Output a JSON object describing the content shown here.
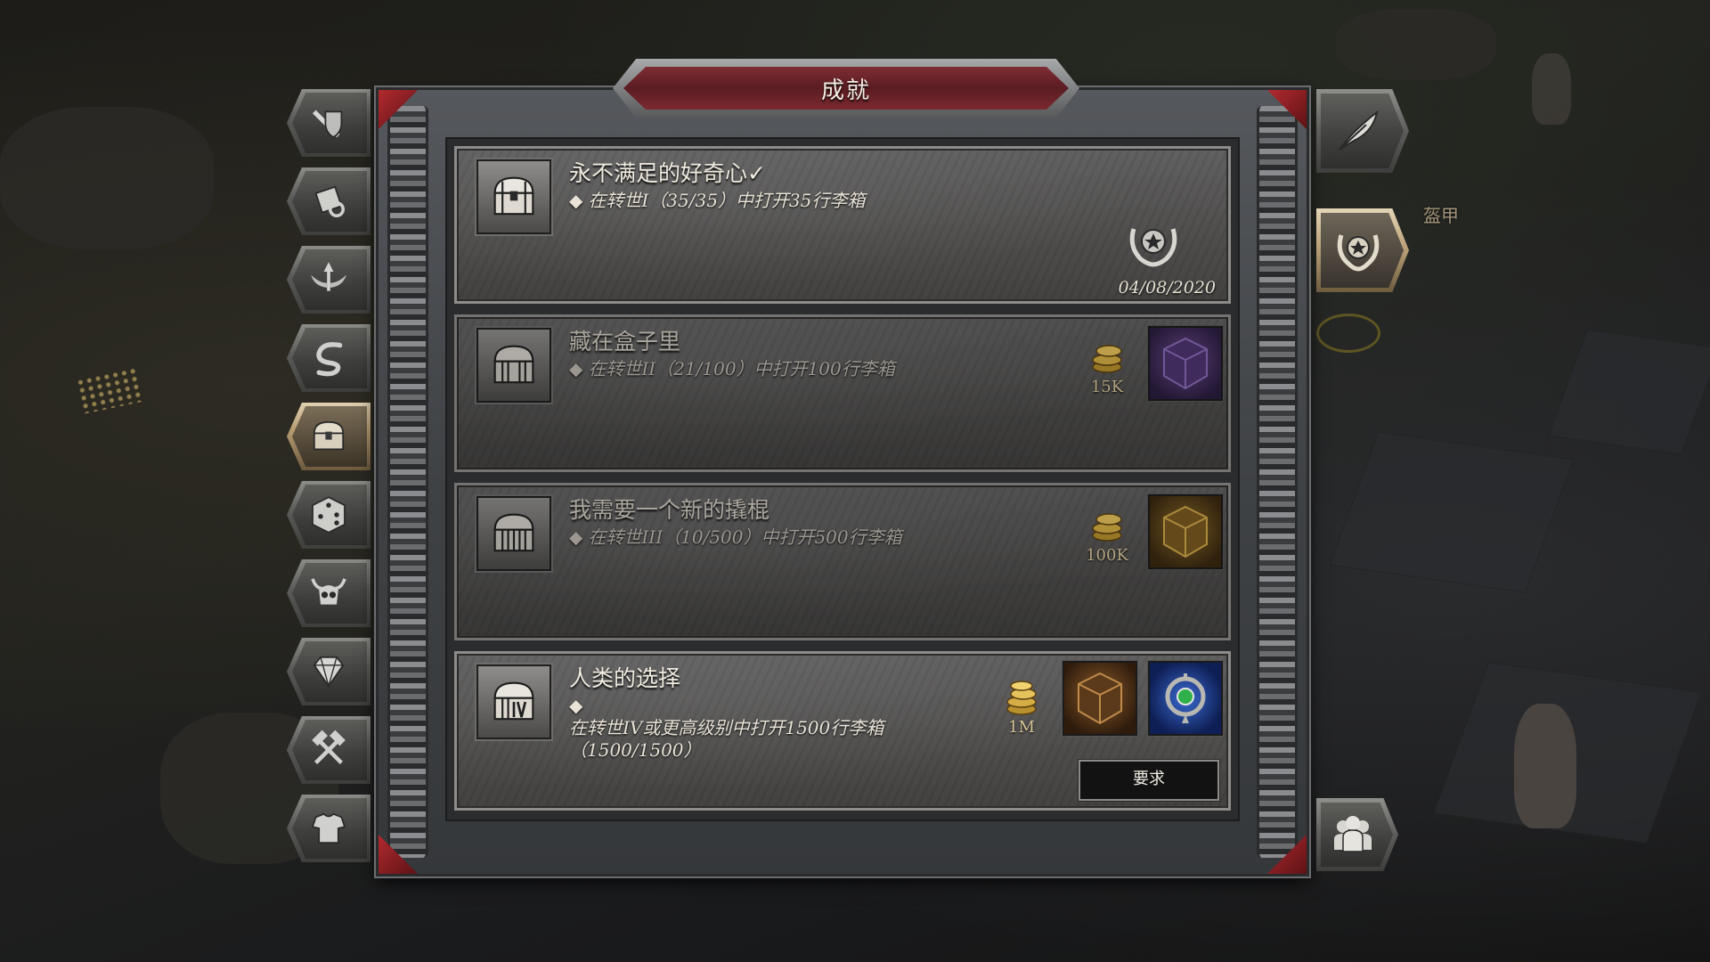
{
  "window": {
    "title": "成就"
  },
  "left_nav": {
    "items": [
      {
        "icon": "sword-shield-icon",
        "active": false
      },
      {
        "icon": "scroll-icon",
        "active": false
      },
      {
        "icon": "winged-arrow-icon",
        "active": false
      },
      {
        "icon": "serpent-icon",
        "active": false
      },
      {
        "icon": "treasure-chest-icon",
        "active": true
      },
      {
        "icon": "dice-icon",
        "active": false
      },
      {
        "icon": "horned-skull-icon",
        "active": false
      },
      {
        "icon": "gem-icon",
        "active": false
      },
      {
        "icon": "crossed-hammers-icon",
        "active": false
      },
      {
        "icon": "armor-icon",
        "active": false
      }
    ]
  },
  "right_side": {
    "buttons": [
      {
        "icon": "feather-quill-icon",
        "active": false
      },
      {
        "icon": "laurel-star-medal-icon",
        "active": true
      },
      {
        "icon": "group-people-icon",
        "active": false
      }
    ],
    "background_label": "盔甲"
  },
  "achievements": [
    {
      "title": "永不满足的好奇心✓",
      "description": "在转世I（35/35）中打开35行李箱",
      "bullet": "◆",
      "completed": true,
      "date": "04/08/2020",
      "icon": "treasure-chest-icon"
    },
    {
      "title": "藏在盒子里",
      "description": "在转世II（21/100）中打开100行李箱",
      "bullet": "◆",
      "completed": false,
      "reward_gold": "15K",
      "reward_items": [
        "purple-rune-cube-icon"
      ],
      "icon": "treasure-chest-icon"
    },
    {
      "title": "我需要一个新的撬棍",
      "description": "在转世III（10/500）中打开500行李箱",
      "bullet": "◆",
      "completed": false,
      "reward_gold": "100K",
      "reward_items": [
        "golden-rune-cube-icon"
      ],
      "icon": "treasure-chest-icon"
    },
    {
      "title": "人类的选择",
      "description": "在转世IV或更高级别中打开1500行李箱（1500/1500）",
      "bullet": "◆",
      "completed": false,
      "reward_gold": "1M",
      "reward_items": [
        "bronze-rune-cube-icon",
        "blue-amulet-icon"
      ],
      "button_label": "要求",
      "icon": "treasure-chest-iv-icon"
    }
  ],
  "colors": {
    "title_plate": "#7e2d33",
    "corner_accent": "#b02a2f",
    "active_nav": "#b79c72",
    "gold_text": "#d8c79a"
  }
}
